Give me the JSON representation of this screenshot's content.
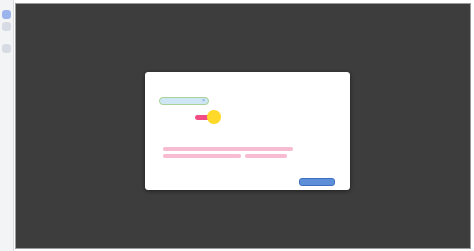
{
  "dialog": {
    "title": "",
    "subtitle": "",
    "pill_label": "",
    "pill_close": "×",
    "row_label": "",
    "field_label_1": "",
    "field_label_2": "",
    "footer_text": "",
    "button_label": ""
  },
  "icons": {
    "rail_top": "blue-square-icon",
    "rail_mid": "grey-square-icon",
    "cursor": "cursor-highlight-icon"
  },
  "colors": {
    "backdrop": "#3d3d3d",
    "dialog": "#ffffff",
    "pill_bg": "#cfe6f4",
    "accent_pink": "#f24c84",
    "cursor": "#ffd92a",
    "error_text": "#f7bcd2",
    "button": "#5d8fd9"
  }
}
